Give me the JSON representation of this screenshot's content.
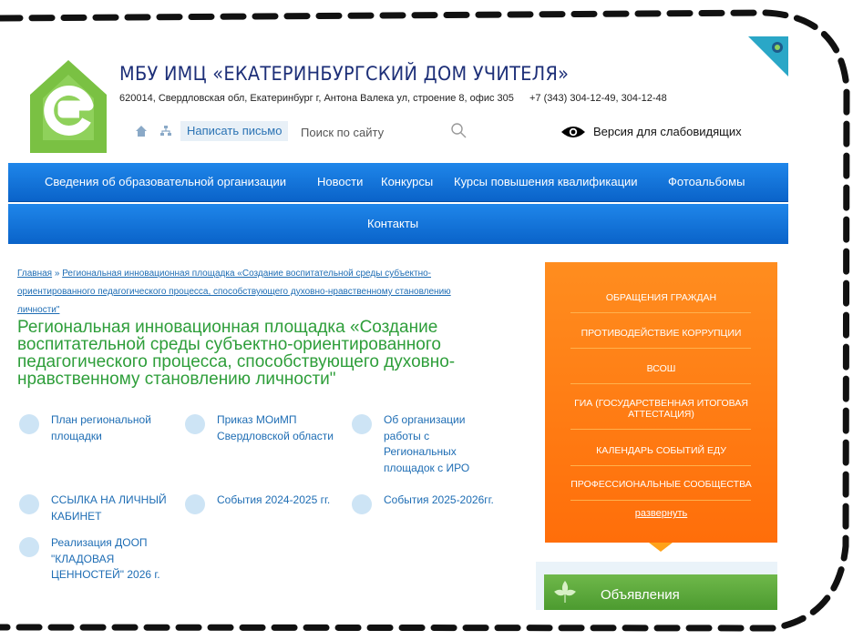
{
  "header": {
    "title": "МБУ ИМЦ «ЕКАТЕРИНБУРГСКИЙ ДОМ УЧИТЕЛЯ»",
    "address": "620014, Свердловская обл, Екатеринбург г, Антона Валека ул, строение 8, офис 305",
    "phone": "+7 (343) 304-12-49, 304-12-48",
    "write_label": "Написать письмо",
    "search_placeholder": "Поиск по сайту",
    "vision_label": "Версия для слабовидящих"
  },
  "nav": {
    "row1": [
      "Сведения об образовательной организации",
      "Новости",
      "Конкурсы",
      "Курсы повышения квалификации",
      "Фотоальбомы"
    ],
    "row2": [
      "Контакты"
    ]
  },
  "breadcrumb": {
    "home": "Главная",
    "separator": " » ",
    "current": "Региональная инновационная площадка «Создание воспитательной среды субъектно-ориентированного педагогического процесса, способствующего духовно-нравственному становлению личности\""
  },
  "page_title": "Региональная инновационная площадка «Создание воспитательной среды субъектно-ориентированного педагогического процесса, способствующего духовно-нравственному становлению личности\"",
  "documents": [
    "План региональной площадки",
    "Приказ МОиМП Свердловской области",
    "Об организации работы с Региональных площадок с ИРО",
    "ССЫЛКА НА ЛИЧНЫЙ КАБИНЕТ",
    "События 2024-2025 гг.",
    "События 2025-2026гг.",
    "Реализация ДООП \"КЛАДОВАЯ ЦЕННОСТЕЙ\" 2026 г."
  ],
  "side_menu": {
    "items": [
      "ОБРАЩЕНИЯ ГРАЖДАН",
      "ПРОТИВОДЕЙСТВИЕ КОРРУПЦИИ",
      "ВСОШ",
      "ГИА (ГОСУДАРСТВЕННАЯ ИТОГОВАЯ АТТЕСТАЦИЯ)",
      "КАЛЕНДАРЬ СОБЫТИЙ ЕДУ",
      "ПРОФЕССИОНАЛЬНЫЕ СООБЩЕСТВА"
    ],
    "expand": "развернуть"
  },
  "announcements": {
    "title": "Объявления"
  },
  "icons": {
    "logo": "house-e-logo",
    "home": "home-icon",
    "sitemap": "sitemap-icon",
    "search": "search-icon",
    "eye": "eye-icon",
    "corner": "globe-icon",
    "announcement": "leaf-icon"
  },
  "colors": {
    "nav": "#0a63c9",
    "title": "#1d2f78",
    "heading": "#2e9e3a",
    "link": "#1e6db4",
    "side_panel": "#ff7410",
    "announcement": "#5aa93a",
    "logo": "#7ac143"
  }
}
